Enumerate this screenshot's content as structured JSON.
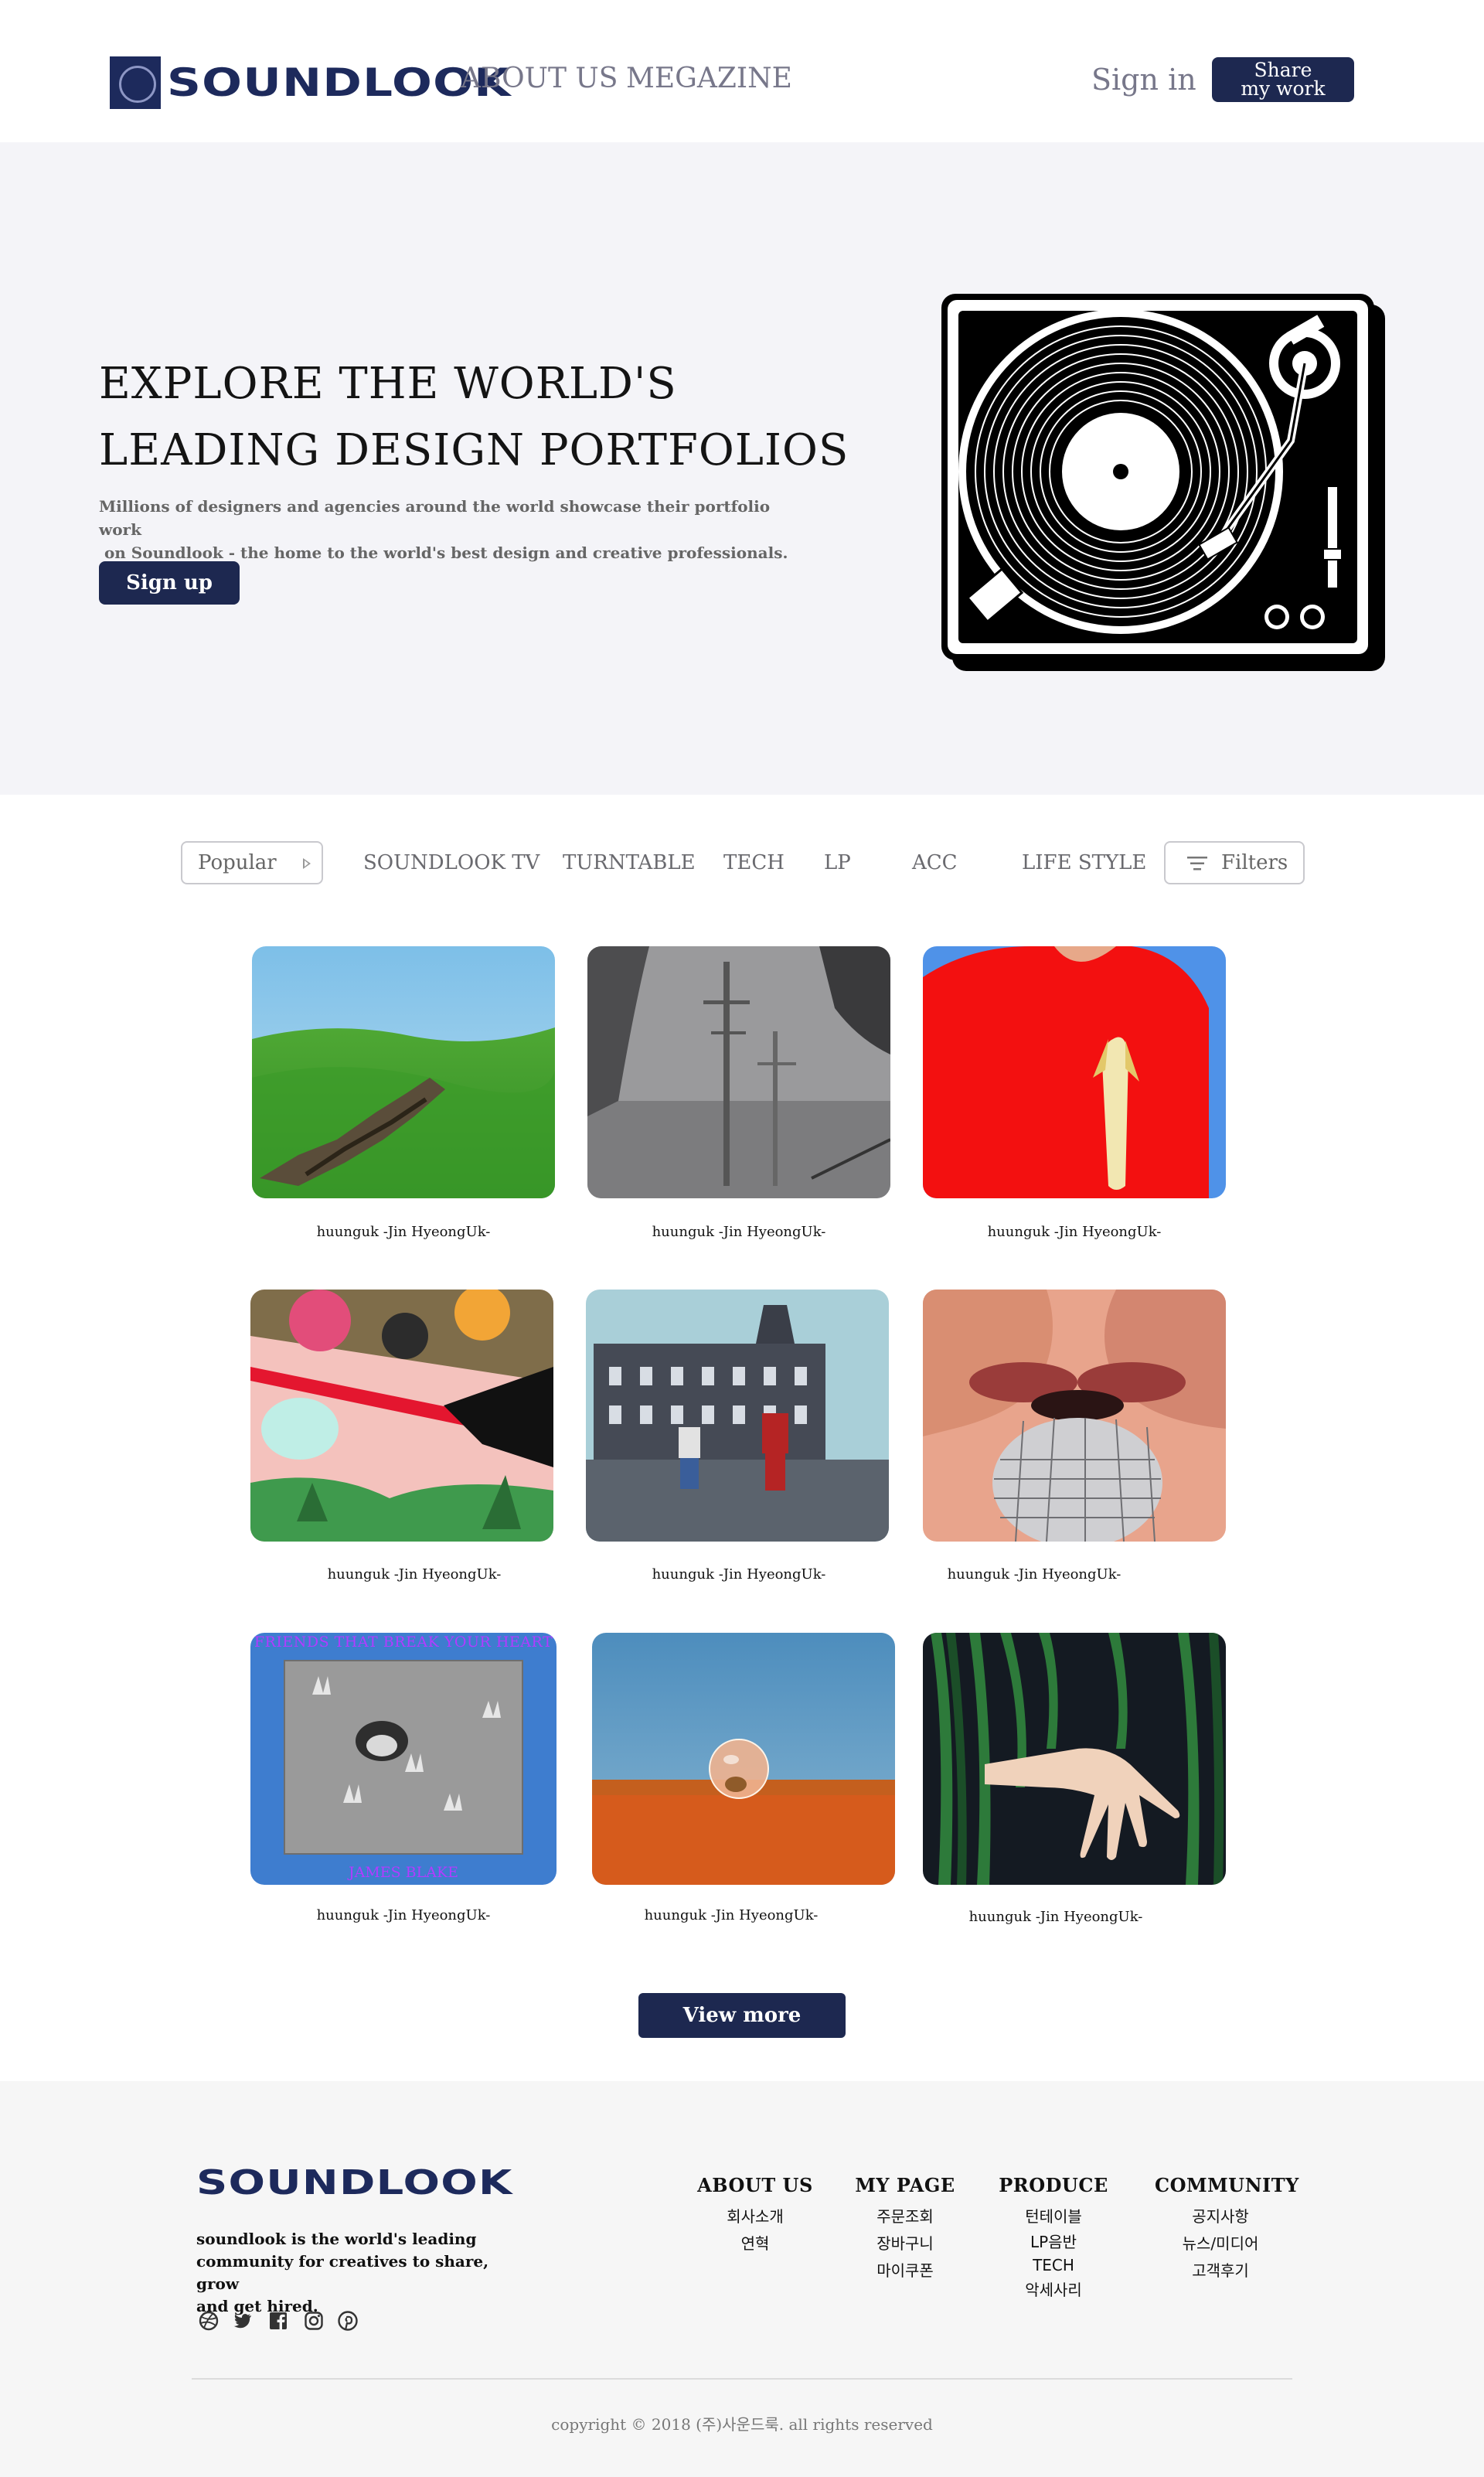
{
  "header": {
    "logo_text": "SOUNDLOOK",
    "nav": [
      "ABOUT US",
      "MEGAZINE"
    ],
    "signin_label": "Sign in",
    "share_label_line1": "Share",
    "share_label_line2": "my work"
  },
  "hero": {
    "title_line1": "EXPLORE THE WORLD'S",
    "title_line2": "LEADING DESIGN PORTFOLIOS",
    "desc_line1": "Millions of designers and agencies around the world showcase their portfolio work",
    "desc_line2": " on Soundlook - the home to the world's best design and creative professionals.",
    "signup_label": "Sign up",
    "image_icon": "turntable-illustration"
  },
  "filters": {
    "sort_selected": "Popular",
    "categories": [
      "SOUNDLOOK TV",
      "TURNTABLE",
      "TECH",
      "LP",
      "ACC",
      "LIFE STYLE"
    ],
    "filters_label": "Filters"
  },
  "cards": [
    {
      "caption": "huunguk -Jin HyeongUk-",
      "image": "green-hills-artwork"
    },
    {
      "caption": "huunguk -Jin HyeongUk-",
      "image": "foggy-power-poles"
    },
    {
      "caption": "huunguk -Jin HyeongUk-",
      "image": "red-shirt-banana"
    },
    {
      "caption": "huunguk -Jin HyeongUk-",
      "image": "pink-collage-artwork"
    },
    {
      "caption": "huunguk -Jin HyeongUk-",
      "image": "kids-in-fog-building"
    },
    {
      "caption": "huunguk -Jin HyeongUk-",
      "image": "lips-microphone"
    },
    {
      "caption": "huunguk -Jin HyeongUk-",
      "image": "album-cover-hands",
      "cover_top": "FRIENDS THAT BREAK YOUR HEART",
      "cover_bottom": "JAMES BLAKE"
    },
    {
      "caption": "huunguk -Jin HyeongUk-",
      "image": "glass-bubble-snail"
    },
    {
      "caption": "huunguk -Jin HyeongUk-",
      "image": "hand-in-grass"
    }
  ],
  "view_more_label": "View more",
  "footer": {
    "logo_text": "SOUNDLOOK",
    "about_line1": "soundlook is the world's leading",
    "about_line2": "community for creatives to share, grow",
    "about_line3": "and get hired.",
    "social_icons": [
      "dribbble-icon",
      "twitter-icon",
      "facebook-icon",
      "instagram-icon",
      "pinterest-icon"
    ],
    "columns": [
      {
        "title": "ABOUT US",
        "items": [
          "회사소개",
          "연혁"
        ]
      },
      {
        "title": "MY PAGE",
        "items": [
          "주문조회",
          "장바구니",
          "마이쿠폰"
        ]
      },
      {
        "title": "PRODUCE",
        "items": [
          "턴테이블",
          "LP음반",
          "TECH",
          "악세사리"
        ]
      },
      {
        "title": "COMMUNITY",
        "items": [
          "공지사항",
          "뉴스/미디어",
          "고객후기"
        ]
      }
    ],
    "copyright": "copyright © 2018 (주)사운드룩. all rights reserved"
  },
  "colors": {
    "primary": "#1d2850",
    "hero_bg": "#f4f4f8",
    "footer_bg": "#f6f6f6"
  }
}
